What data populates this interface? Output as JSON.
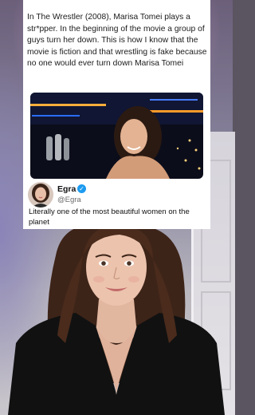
{
  "post": {
    "caption": "In The Wrestler (2008), Marisa Tomei plays a str*pper. In the beginning of the movie a group of guys turn her down. This is how I know that the movie is fiction and that wrestling is fake because no one would ever turn down Marisa Tomei"
  },
  "tweet": {
    "display_name": "Egra",
    "handle": "@Egra",
    "verified_glyph": "✓",
    "text": "Literally one of the most beautiful women on the planet"
  },
  "colors": {
    "card_background": "#ffffff",
    "verified_badge": "#1d9bf0",
    "room_glow": "#e9a8d8"
  }
}
